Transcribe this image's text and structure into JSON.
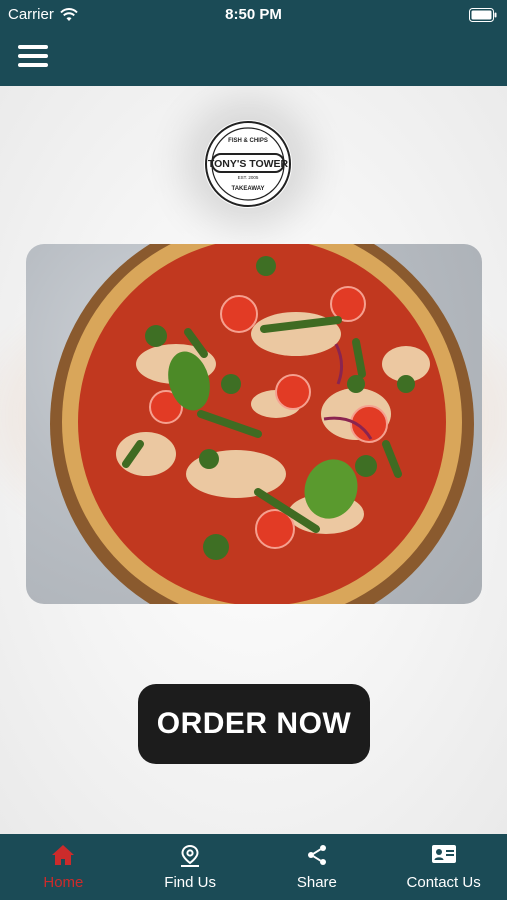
{
  "status_bar": {
    "carrier": "Carrier",
    "time": "8:50 PM"
  },
  "header": {
    "menu_icon": "hamburger-menu-icon",
    "bg_color": "#1b4b56"
  },
  "logo": {
    "top_text": "FISH & CHIPS",
    "name": "TONY'S TOWER",
    "middle_text": "EST. 2005",
    "bottom_text": "TAKEAWAY"
  },
  "hero": {
    "image": "pizza-photo"
  },
  "order_button": {
    "label": "ORDER NOW"
  },
  "tabs": [
    {
      "label": "Home",
      "icon": "home-icon",
      "active": true
    },
    {
      "label": "Find Us",
      "icon": "location-pin-icon",
      "active": false
    },
    {
      "label": "Share",
      "icon": "share-icon",
      "active": false
    },
    {
      "label": "Contact Us",
      "icon": "contact-card-icon",
      "active": false
    }
  ],
  "colors": {
    "accent": "#cc2b2b",
    "bar": "#1b4b56",
    "button": "#1c1c1c"
  }
}
